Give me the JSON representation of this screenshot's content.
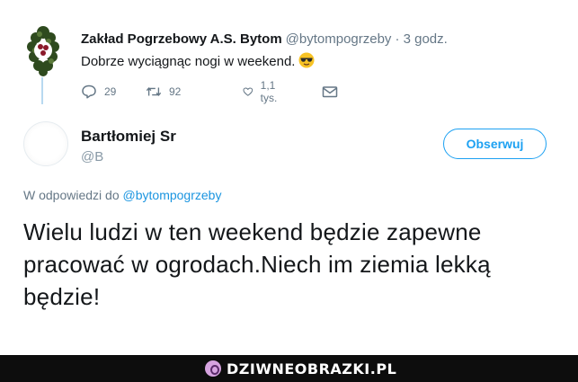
{
  "parent_tweet": {
    "name": "Zakład Pogrzebowy A.S. Bytom",
    "handle": "@bytompogrzeby",
    "time": "· 3 godz.",
    "text": "Dobrze wyciągnąc nogi w weekend.",
    "emoji_icon": "sunglasses-emoji-icon",
    "avatar_icon": "funeral-wreath-icon",
    "actions": {
      "replies": "29",
      "retweets": "92",
      "likes": "1,1 tys."
    }
  },
  "reply_tweet": {
    "name": "Bartłomiej Sr",
    "handle": "@B",
    "follow_label": "Obserwuj",
    "reply_prefix": "W odpowiedzi do",
    "reply_to_handle": "@bytompogrzeby",
    "text": "Wielu ludzi w ten weekend będzie zapewne pracować w ogrodach.Niech im ziemia lekką będzie!"
  },
  "footer": {
    "brand": "DZIWNEOBRAZKI.PL"
  },
  "colors": {
    "accent": "#1da1f2",
    "link": "#1b95e0",
    "muted": "#657786",
    "footer_bg": "#0d0d0d"
  }
}
